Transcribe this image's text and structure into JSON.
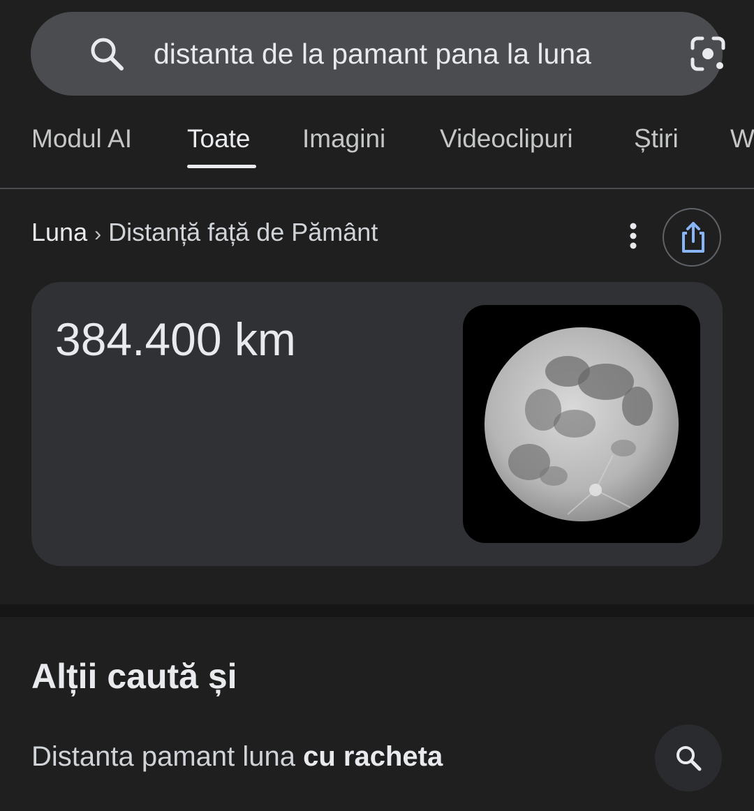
{
  "search": {
    "query": "distanta de la pamant pana la luna",
    "search_icon": "search-icon",
    "lens_icon": "camera-lens-icon"
  },
  "tabs": [
    {
      "label": "Modul AI",
      "active": false
    },
    {
      "label": "Toate",
      "active": true
    },
    {
      "label": "Imagini",
      "active": false
    },
    {
      "label": "Videoclipuri",
      "active": false
    },
    {
      "label": "Știri",
      "active": false
    },
    {
      "label": "W",
      "active": false
    }
  ],
  "breadcrumb": {
    "root": "Luna",
    "separator": "›",
    "leaf": "Distanță față de Pământ"
  },
  "answer": {
    "value": "384.400 km",
    "image": "moon-image"
  },
  "related": {
    "title": "Alții caută și",
    "items": [
      {
        "prefix": "Distanta pamant luna ",
        "bold": "cu racheta"
      }
    ]
  },
  "colors": {
    "background": "#1f1f1f",
    "search_bar": "#4a4c50",
    "card": "#303134",
    "text": "#e8eaed"
  }
}
